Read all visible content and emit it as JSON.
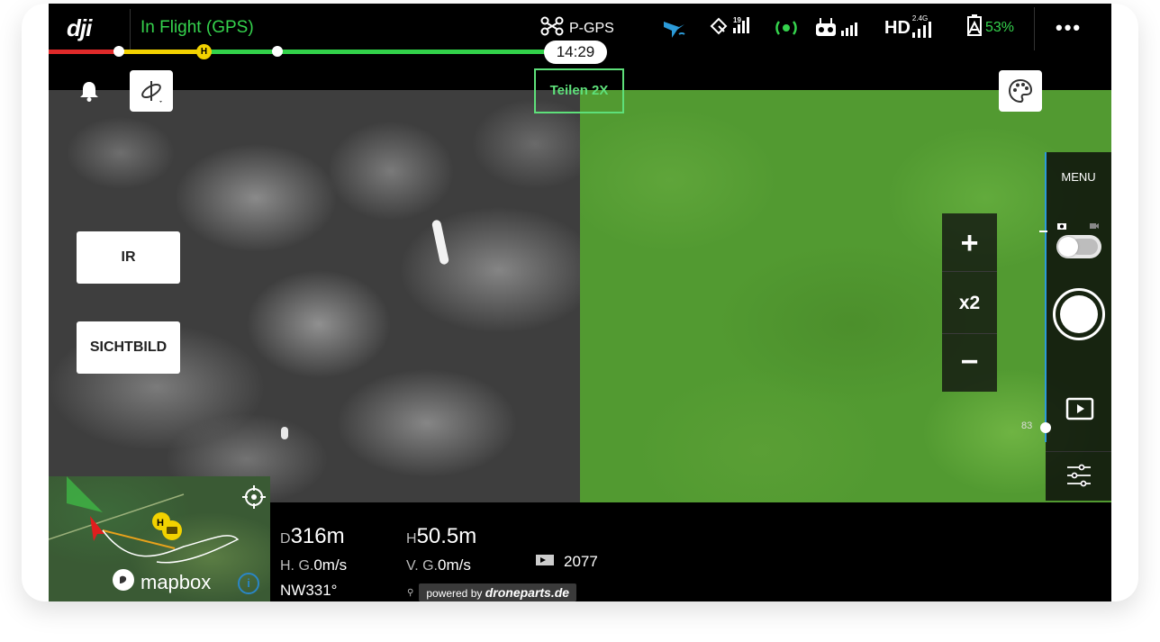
{
  "app": {
    "logo": "dji"
  },
  "status_bar": {
    "flight_status": "In Flight (GPS)",
    "mode": "P-GPS",
    "flight_time": "14:29",
    "satellites": "19",
    "hd_band": "2.4G",
    "hd_label": "HD",
    "battery_percent": "53%",
    "more": "•••"
  },
  "toolbar": {
    "split_label": "Teilen 2X"
  },
  "view_buttons": {
    "ir_label": "IR",
    "visible_label": "SICHTBILD"
  },
  "zoom": {
    "plus": "+",
    "level": "x2",
    "minus": "−"
  },
  "camera_panel": {
    "menu_label": "MENU",
    "slider_value": "83"
  },
  "map": {
    "brand": "mapbox",
    "info": "i"
  },
  "telemetry": {
    "d_prefix": "D",
    "distance": "316m",
    "h_prefix": "H",
    "height": "50.5m",
    "hg_prefix": "H. G.",
    "horizontal_speed": "0m/s",
    "vg_prefix": "V. G.",
    "vertical_speed": "0m/s",
    "heading": "NW331°",
    "remaining": "2077",
    "powered_by": "powered by",
    "powered_brand": "droneparts.de"
  },
  "colors": {
    "accent_green": "#35d34d",
    "timeline_red": "#e02a2a",
    "timeline_yellow": "#f2d200",
    "slider_blue": "#2c9bd9"
  },
  "icons": [
    "dji-logo",
    "drone-icon",
    "aircraft-signal-icon",
    "satellite-icon",
    "obstacle-sensor-icon",
    "remote-controller-icon",
    "battery-icon",
    "bell-icon",
    "gimbal-icon",
    "palette-icon",
    "photo-icon",
    "video-icon",
    "shutter-icon",
    "playback-icon",
    "settings-sliders-icon",
    "locate-icon",
    "mapbox-icon",
    "info-icon",
    "battery-time-icon"
  ]
}
